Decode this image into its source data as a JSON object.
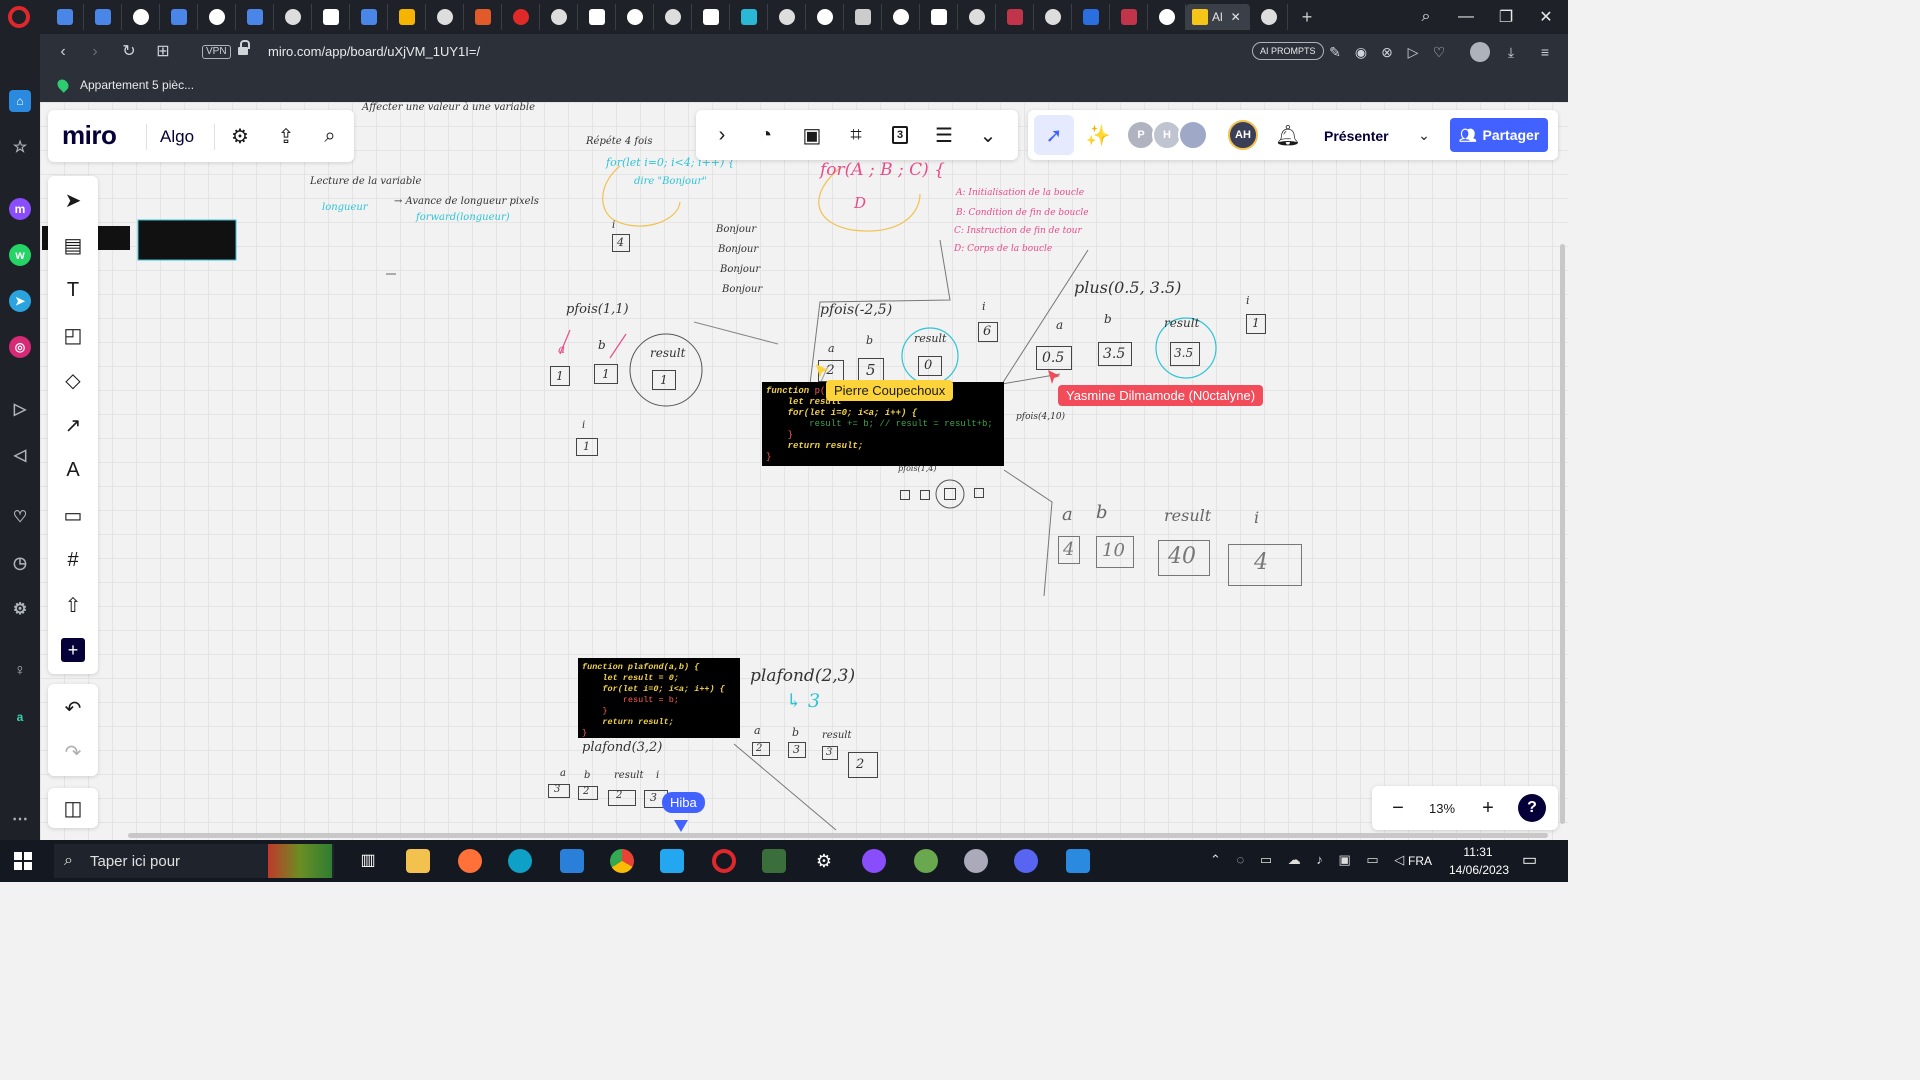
{
  "browser": {
    "url": "miro.com/app/board/uXjVM_1UY1I=/",
    "vpn_label": "VPN",
    "ai_prompts_label": "AI PROMPTS",
    "active_tab_label": "Al",
    "bookmark_label": "Appartement 5 pièc..."
  },
  "miro": {
    "logo": "miro",
    "board_name": "Algo",
    "present_label": "Présenter",
    "share_label": "Partager",
    "zoom": "13%",
    "help_label": "?",
    "frame_count": "3",
    "avatars": [
      {
        "initials": "P",
        "color": "#b0b4c0"
      },
      {
        "initials": "H",
        "color": "#c0c4d0"
      },
      {
        "initials": "AH",
        "color": "#3a3e56"
      }
    ]
  },
  "cursors": [
    {
      "name": "Pierre Coupechoux",
      "color": "#fcd33b",
      "text_color": "#1a1a1a"
    },
    {
      "name": "Yasmine Dilmamode (N0ctalyne)",
      "color": "#f24c5a",
      "text_color": "#ffffff"
    },
    {
      "name": "Hiba",
      "color": "#4262ff",
      "text_color": "#ffffff"
    }
  ],
  "code_blocks": {
    "pfois": {
      "line1_kw": "function",
      "line1_rest": " p(",
      "line2": "    let result",
      "line3": "    for(let i=0; i<a; i++) {",
      "line4": "        result += b; // result = result+b;",
      "line5": "    }",
      "line6": "    return result;",
      "line7": "}"
    },
    "plafond": {
      "line1": "function plafond(a,b) {",
      "line2": "    let result = 0;",
      "line3": "    for(let i=0; i<a; i++) {",
      "line4": "        result = b;",
      "line5": "    }",
      "line6": "    return result;",
      "line7": "}"
    }
  },
  "handwriting": {
    "affect": "Affecter une valeur à une variable",
    "lecture": "Lecture de la variable",
    "longueur": "longueur",
    "avance": "→ Avance de longueur pixels",
    "forward": "forward(longueur)",
    "repete": "Répéte 4 fois",
    "for_loop": "for(let i=0; i<4; i++) {",
    "bonjour_call": "dire \"Bonjour\"",
    "bonjours": [
      "Bonjour",
      "Bonjour",
      "Bonjour",
      "Bonjour"
    ],
    "for_abc": "for(A ; B ; C) {",
    "d": "D",
    "legend_a": "A: Initialisation de la boucle",
    "legend_b": "B: Condition de fin de boucle",
    "legend_c": "C: Instruction de fin de tour",
    "legend_d": "D: Corps de la boucle",
    "pfois_1_1": "pfois(1,1)",
    "pfois_neg": "pfois(-2,5)",
    "pfois_4_10": "pfois(4,10)",
    "pfois_small": "pfois(1,4)",
    "plus": "plus(0.5, 3.5)",
    "plafond_2_3": "plafond(2,3)",
    "plafond_arrow": "↳ 3",
    "plafond_3_2": "plafond(3,2)",
    "a": "a",
    "b": "b",
    "result": "result",
    "i": "i",
    "v1": "1",
    "v4": "4",
    "v5": "5",
    "v0": "0",
    "v6": "6",
    "v10": "10",
    "v40": "40",
    "v05": "0.5",
    "v35": "3.5",
    "v2": "2",
    "v3": "3",
    "vneg2": "-2"
  },
  "taskbar": {
    "search_placeholder": "Taper ici pour",
    "lang": "FRA",
    "time": "11:31",
    "date": "14/06/2023"
  }
}
